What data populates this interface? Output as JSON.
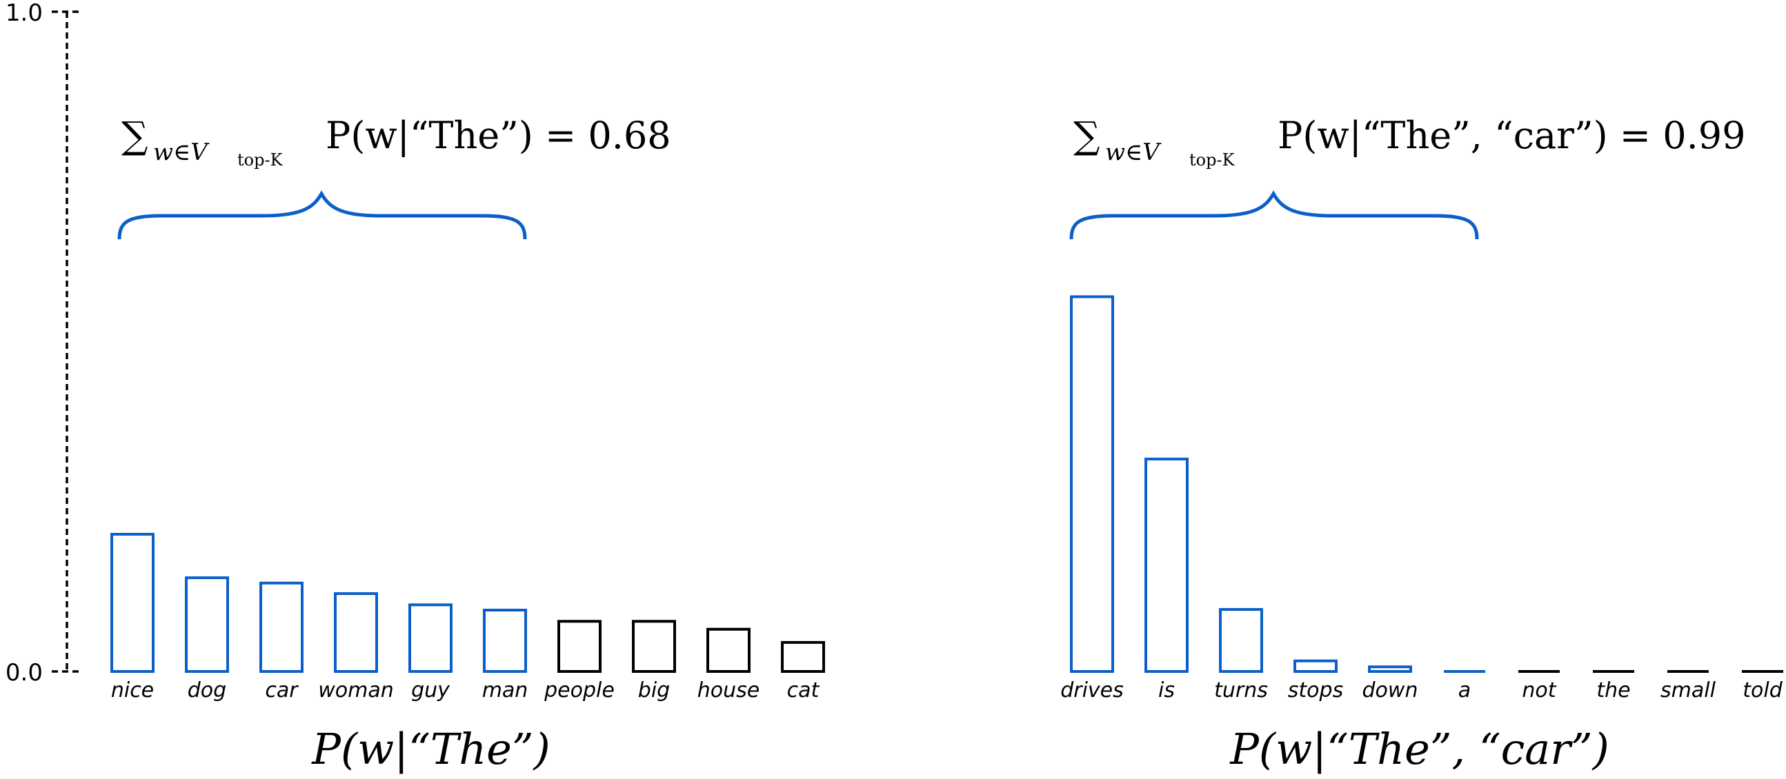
{
  "colors": {
    "top_k": "#0b5fc8",
    "other": "#000000"
  },
  "chart_data": [
    {
      "type": "bar",
      "style": "outline",
      "xlabel": "P(w|“The”)",
      "ylabel": "",
      "ylim": [
        0.0,
        1.0
      ],
      "yticks": [
        "0.0",
        "1.0"
      ],
      "ytick_values": [
        0.0,
        1.0
      ],
      "axis_style": "dashed",
      "categories": [
        "nice",
        "dog",
        "car",
        "woman",
        "guy",
        "man",
        "people",
        "big",
        "house",
        "cat"
      ],
      "values": [
        0.208,
        0.142,
        0.134,
        0.118,
        0.101,
        0.093,
        0.076,
        0.076,
        0.064,
        0.044
      ],
      "in_top_k": [
        true,
        true,
        true,
        true,
        true,
        true,
        false,
        false,
        false,
        false
      ],
      "annotation": {
        "sum_symbol": "∑",
        "subscript": "w∈V",
        "subsubscript": "top-K",
        "expression": "P(w|“The”) = 0.68",
        "value": 0.68
      }
    },
    {
      "type": "bar",
      "style": "outline",
      "xlabel": "P(w|“The”, “car”)",
      "ylabel": "",
      "ylim": [
        0.0,
        1.0
      ],
      "categories": [
        "drives",
        "is",
        "turns",
        "stops",
        "down",
        "a",
        "not",
        "the",
        "small",
        "told"
      ],
      "values": [
        0.568,
        0.322,
        0.094,
        0.016,
        0.007,
        0.001,
        0.0,
        0.0,
        0.0,
        0.0
      ],
      "in_top_k": [
        true,
        true,
        true,
        true,
        true,
        true,
        false,
        false,
        false,
        false
      ],
      "annotation": {
        "sum_symbol": "∑",
        "subscript": "w∈V",
        "subsubscript": "top-K",
        "expression": "P(w|“The”, “car”) = 0.99",
        "value": 0.99
      }
    }
  ]
}
